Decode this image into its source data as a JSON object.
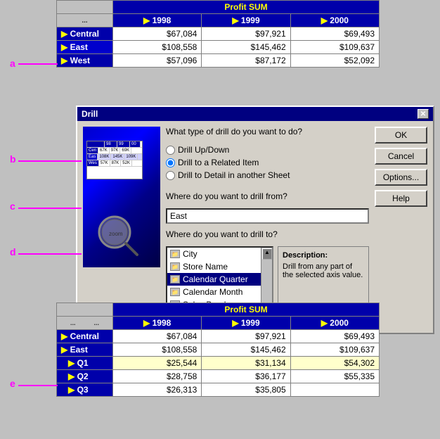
{
  "annotations": {
    "a_label": "a",
    "b_label": "b",
    "c_label": "c",
    "d_label": "d",
    "e_label": "e"
  },
  "top_table": {
    "header": "Profit SUM",
    "columns": [
      "1998",
      "1999",
      "2000"
    ],
    "rows": [
      {
        "label": "Central",
        "values": [
          "$67,084",
          "$97,921",
          "$69,493"
        ]
      },
      {
        "label": "East",
        "values": [
          "$108,558",
          "$145,462",
          "$109,637"
        ],
        "selected": true
      },
      {
        "label": "West",
        "values": [
          "$57,096",
          "$87,172",
          "$52,092"
        ]
      }
    ]
  },
  "dialog": {
    "title": "Drill",
    "question": "What type of drill do you want to do?",
    "options": [
      {
        "id": "drill_up_down",
        "label": "Drill Up/Down"
      },
      {
        "id": "drill_related",
        "label": "Drill to a Related Item",
        "selected": true
      },
      {
        "id": "drill_detail",
        "label": "Drill to Detail in another Sheet"
      }
    ],
    "from_label": "Where do you want to drill from?",
    "from_value": "East",
    "to_label": "Where do you want to drill to?",
    "to_items": [
      {
        "id": "city",
        "label": "City"
      },
      {
        "id": "store_name",
        "label": "Store Name"
      },
      {
        "id": "cal_quarter",
        "label": "Calendar Quarter",
        "selected": true
      },
      {
        "id": "cal_month",
        "label": "Calendar Month"
      },
      {
        "id": "sales_band",
        "label": "Sales Band"
      }
    ],
    "description_title": "Description:",
    "description_text": "Drill from any part of the selected axis value.",
    "buttons": [
      {
        "id": "ok",
        "label": "OK"
      },
      {
        "id": "cancel",
        "label": "Cancel"
      },
      {
        "id": "options",
        "label": "Options..."
      },
      {
        "id": "help",
        "label": "Help"
      }
    ]
  },
  "bottom_table": {
    "header": "Profit SUM",
    "columns": [
      "1998",
      "1999",
      "2000"
    ],
    "rows": [
      {
        "label": "Central",
        "values": [
          "$67,084",
          "$97,921",
          "$69,493"
        ],
        "indent": false
      },
      {
        "label": "East",
        "values": [
          "$108,558",
          "$145,462",
          "$109,637"
        ],
        "indent": false,
        "bold": true
      },
      {
        "label": "Q1",
        "values": [
          "$25,544",
          "$31,134",
          "$54,302"
        ],
        "indent": true
      },
      {
        "label": "Q2",
        "values": [
          "$28,758",
          "$36,177",
          "$55,335"
        ],
        "indent": true
      },
      {
        "label": "Q3",
        "values": [
          "$26,313",
          "$35,805",
          ""
        ],
        "indent": true
      }
    ]
  }
}
